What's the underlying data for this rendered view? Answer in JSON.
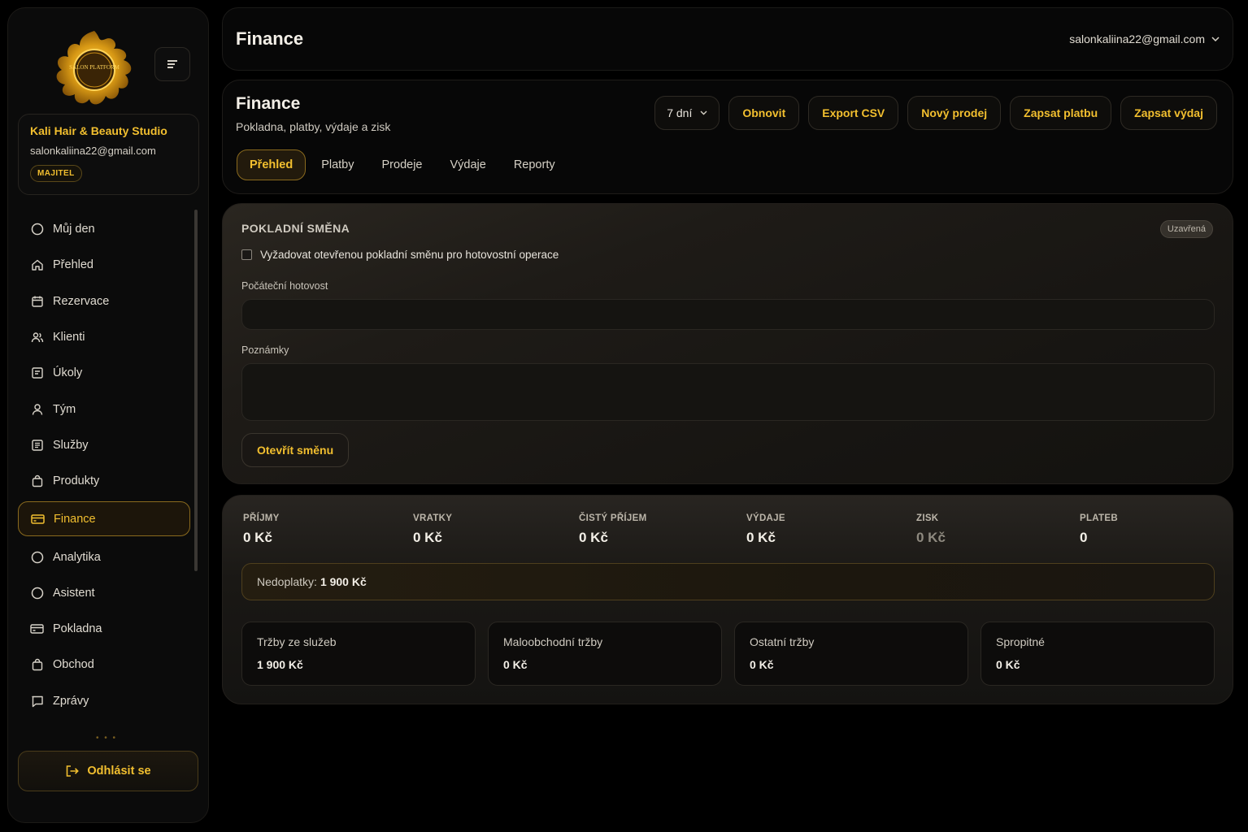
{
  "brand": {
    "logo_text": "SALON PLATFORM"
  },
  "profile": {
    "name": "Kali Hair & Beauty Studio",
    "email": "salonkaliina22@gmail.com",
    "role": "MAJITEL"
  },
  "nav": {
    "items": [
      {
        "label": "Můj den",
        "icon": "circle-icon"
      },
      {
        "label": "Přehled",
        "icon": "home-icon"
      },
      {
        "label": "Rezervace",
        "icon": "calendar-icon"
      },
      {
        "label": "Klienti",
        "icon": "users-icon"
      },
      {
        "label": "Úkoly",
        "icon": "task-icon"
      },
      {
        "label": "Tým",
        "icon": "user-icon"
      },
      {
        "label": "Služby",
        "icon": "list-icon"
      },
      {
        "label": "Produkty",
        "icon": "bag-icon"
      },
      {
        "label": "Finance",
        "icon": "card-icon",
        "active": true
      },
      {
        "label": "Analytika",
        "icon": "circle-icon"
      },
      {
        "label": "Asistent",
        "icon": "circle-icon"
      },
      {
        "label": "Pokladna",
        "icon": "card-icon"
      },
      {
        "label": "Obchod",
        "icon": "bag-icon"
      },
      {
        "label": "Zprávy",
        "icon": "message-icon"
      }
    ],
    "logout_label": "Odhlásit se"
  },
  "topbar": {
    "title": "Finance",
    "user_email": "salonkaliina22@gmail.com"
  },
  "header": {
    "title": "Finance",
    "subtitle": "Pokladna, platby, výdaje a zisk",
    "period_select": "7 dní",
    "actions": [
      "Obnovit",
      "Export CSV",
      "Nový prodej",
      "Zapsat platbu",
      "Zapsat výdaj"
    ],
    "tabs": [
      "Přehled",
      "Platby",
      "Prodeje",
      "Výdaje",
      "Reporty"
    ],
    "active_tab": "Přehled"
  },
  "shift": {
    "title": "POKLADNÍ SMĚNA",
    "status": "Uzavřená",
    "require_label": "Vyžadovat otevřenou pokladní směnu pro hotovostní operace",
    "require_checked": false,
    "opening_cash_label": "Počáteční hotovost",
    "opening_cash_value": "",
    "notes_label": "Poznámky",
    "notes_value": "",
    "open_button": "Otevřít směnu"
  },
  "stats": {
    "items": [
      {
        "key": "PŘÍJMY",
        "value": "0 Kč"
      },
      {
        "key": "VRATKY",
        "value": "0 Kč"
      },
      {
        "key": "ČISTÝ PŘÍJEM",
        "value": "0 Kč"
      },
      {
        "key": "VÝDAJE",
        "value": "0 Kč"
      },
      {
        "key": "ZISK",
        "value": "0 Kč"
      },
      {
        "key": "PLATEB",
        "value": "0"
      }
    ],
    "arrears_label": "Nedoplatky:",
    "arrears_value": "1 900 Kč",
    "cards": [
      {
        "label": "Tržby ze služeb",
        "value": "1 900 Kč"
      },
      {
        "label": "Maloobchodní tržby",
        "value": "0 Kč"
      },
      {
        "label": "Ostatní tržby",
        "value": "0 Kč"
      },
      {
        "label": "Spropitné",
        "value": "0 Kč"
      }
    ]
  },
  "colors": {
    "accent": "#f2bf2f",
    "background": "#000000",
    "panel": "#1e1b17"
  }
}
